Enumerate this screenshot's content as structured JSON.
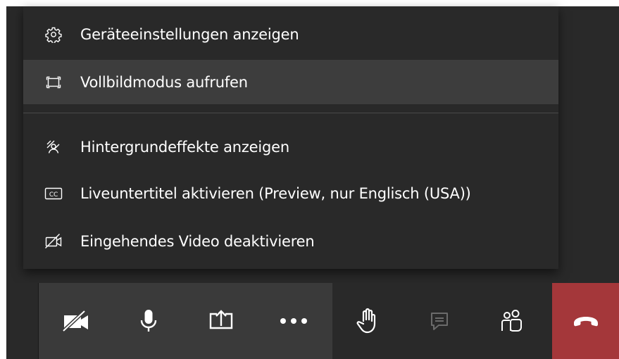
{
  "menu": {
    "items": [
      {
        "label": "Geräteeinstellungen anzeigen",
        "icon": "gear-icon"
      },
      {
        "label": "Vollbildmodus aufrufen",
        "icon": "fullscreen-icon",
        "highlighted": true
      },
      {
        "label": "Hintergrundeffekte anzeigen",
        "icon": "background-effects-icon"
      },
      {
        "label": "Liveuntertitel aktivieren (Preview, nur Englisch (USA))",
        "icon": "closed-captions-icon"
      },
      {
        "label": "Eingehendes Video deaktivieren",
        "icon": "video-off-icon"
      }
    ]
  },
  "toolbar": {
    "buttons": [
      {
        "icon": "camera-off-icon"
      },
      {
        "icon": "microphone-icon"
      },
      {
        "icon": "share-screen-icon"
      },
      {
        "icon": "more-actions-icon"
      },
      {
        "icon": "raise-hand-icon"
      },
      {
        "icon": "chat-icon",
        "disabled": true
      },
      {
        "icon": "participants-icon"
      },
      {
        "icon": "hang-up-icon"
      }
    ]
  },
  "colors": {
    "background": "#292929",
    "menu_hover": "#3d3d3d",
    "toolbar_group": "#3a3a3a",
    "hangup": "#a4373a",
    "text": "#ffffff",
    "disabled_icon": "#6b6b6b"
  }
}
